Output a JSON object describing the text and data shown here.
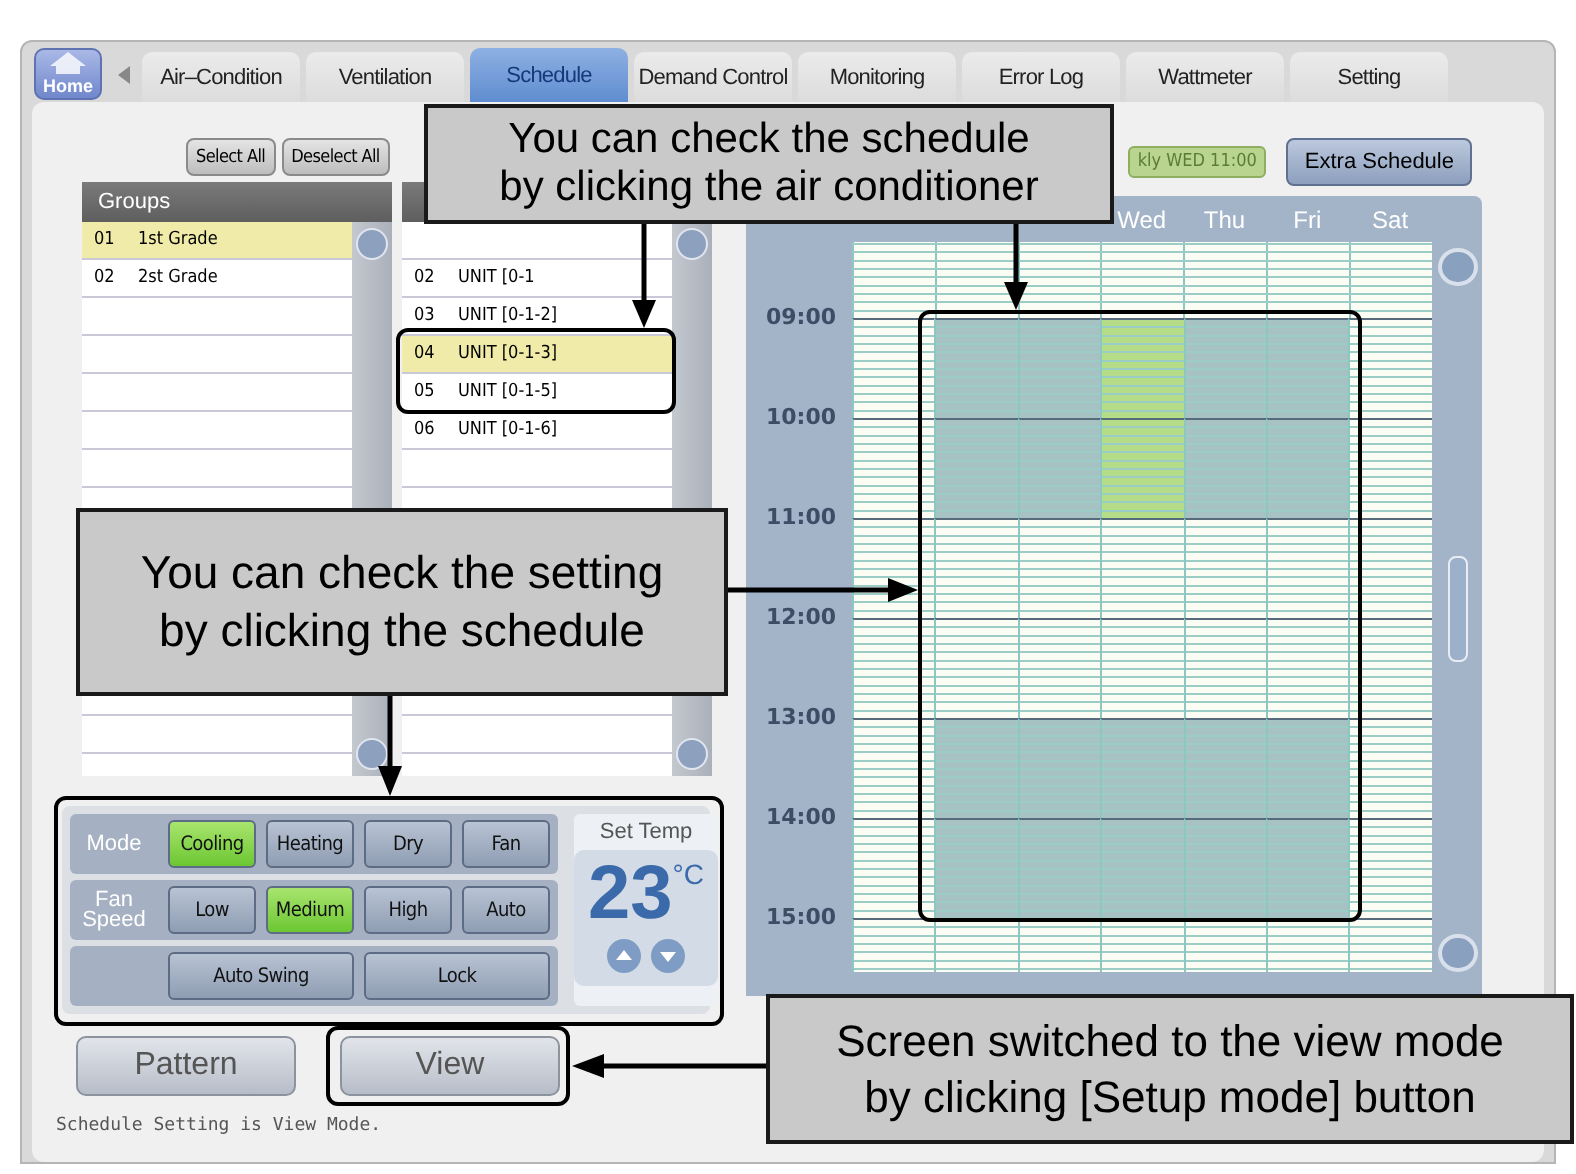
{
  "tabs": {
    "home": "Home",
    "items": [
      {
        "label": "Air–Condition",
        "selected": false
      },
      {
        "label": "Ventilation",
        "selected": false
      },
      {
        "label": "Schedule",
        "selected": true
      },
      {
        "label": "Demand Control",
        "selected": false
      },
      {
        "label": "Monitoring",
        "selected": false
      },
      {
        "label": "Error Log",
        "selected": false
      },
      {
        "label": "Wattmeter",
        "selected": false
      },
      {
        "label": "Setting",
        "selected": false
      }
    ]
  },
  "group_buttons": [
    "Select All",
    "Deselect All"
  ],
  "groups": {
    "title": "Groups",
    "rows": [
      {
        "num": "01",
        "name": "1st Grade",
        "selected": true
      },
      {
        "num": "02",
        "name": "2st Grade",
        "selected": false
      }
    ]
  },
  "units": {
    "rows": [
      {
        "num": "02",
        "name": "UNIT [0-1",
        "selected": false
      },
      {
        "num": "03",
        "name": "UNIT [0-1-2]",
        "selected": false
      },
      {
        "num": "04",
        "name": "UNIT [0-1-3]",
        "selected": true
      },
      {
        "num": "05",
        "name": "UNIT [0-1-5]",
        "selected": false
      },
      {
        "num": "06",
        "name": "UNIT [0-1-6]",
        "selected": false
      }
    ]
  },
  "controls": {
    "rows": [
      {
        "label": "Mode",
        "buttons": [
          {
            "label": "Cooling",
            "selected": true
          },
          {
            "label": "Heating",
            "selected": false
          },
          {
            "label": "Dry",
            "selected": false
          },
          {
            "label": "Fan",
            "selected": false
          }
        ]
      },
      {
        "label": "Fan Speed",
        "buttons": [
          {
            "label": "Low",
            "selected": false
          },
          {
            "label": "Medium",
            "selected": true
          },
          {
            "label": "High",
            "selected": false
          },
          {
            "label": "Auto",
            "selected": false
          }
        ]
      },
      {
        "buttons": [
          {
            "label": "Auto Swing",
            "selected": false
          },
          {
            "label": "Lock",
            "selected": false
          }
        ]
      }
    ],
    "set_temp": {
      "label": "Set Temp",
      "value": "23",
      "unit": "°C"
    }
  },
  "bottom_buttons": [
    "Pattern",
    "View"
  ],
  "status": "Schedule Setting is View Mode.",
  "schedule": {
    "current": "kly WED 11:00",
    "extra_button": "Extra Schedule",
    "days": [
      "Wed",
      "Thu",
      "Fri",
      "Sat"
    ],
    "hours": [
      {
        "label": "09:00",
        "cells": [
          {
            "scheduled": false,
            "selected": false
          },
          {
            "scheduled": true,
            "selected": false
          },
          {
            "scheduled": true,
            "selected": false
          },
          {
            "scheduled": true,
            "selected": true
          },
          {
            "scheduled": true,
            "selected": false
          },
          {
            "scheduled": true,
            "selected": false
          },
          {
            "scheduled": false,
            "selected": false
          }
        ]
      },
      {
        "label": "10:00",
        "cells": [
          {
            "scheduled": false,
            "selected": false
          },
          {
            "scheduled": true,
            "selected": false
          },
          {
            "scheduled": true,
            "selected": false
          },
          {
            "scheduled": true,
            "selected": true
          },
          {
            "scheduled": true,
            "selected": false
          },
          {
            "scheduled": true,
            "selected": false
          },
          {
            "scheduled": false,
            "selected": false
          }
        ]
      },
      {
        "label": "11:00",
        "cells": [
          {
            "scheduled": false,
            "selected": false
          },
          {
            "scheduled": false,
            "selected": false
          },
          {
            "scheduled": false,
            "selected": false
          },
          {
            "scheduled": false,
            "selected": false
          },
          {
            "scheduled": false,
            "selected": false
          },
          {
            "scheduled": false,
            "selected": false
          },
          {
            "scheduled": false,
            "selected": false
          }
        ]
      },
      {
        "label": "12:00",
        "cells": [
          {
            "scheduled": false,
            "selected": false
          },
          {
            "scheduled": false,
            "selected": false
          },
          {
            "scheduled": false,
            "selected": false
          },
          {
            "scheduled": false,
            "selected": false
          },
          {
            "scheduled": false,
            "selected": false
          },
          {
            "scheduled": false,
            "selected": false
          },
          {
            "scheduled": false,
            "selected": false
          }
        ]
      },
      {
        "label": "13:00",
        "cells": [
          {
            "scheduled": false,
            "selected": false
          },
          {
            "scheduled": true,
            "selected": false
          },
          {
            "scheduled": true,
            "selected": false
          },
          {
            "scheduled": true,
            "selected": false
          },
          {
            "scheduled": true,
            "selected": false
          },
          {
            "scheduled": true,
            "selected": false
          },
          {
            "scheduled": false,
            "selected": false
          }
        ]
      },
      {
        "label": "14:00",
        "cells": [
          {
            "scheduled": false,
            "selected": false
          },
          {
            "scheduled": true,
            "selected": false
          },
          {
            "scheduled": true,
            "selected": false
          },
          {
            "scheduled": true,
            "selected": false
          },
          {
            "scheduled": true,
            "selected": false
          },
          {
            "scheduled": true,
            "selected": false
          },
          {
            "scheduled": false,
            "selected": false
          }
        ]
      },
      {
        "label": "15:00",
        "cells": [
          {
            "scheduled": false,
            "selected": false
          },
          {
            "scheduled": false,
            "selected": false
          },
          {
            "scheduled": false,
            "selected": false
          },
          {
            "scheduled": false,
            "selected": false
          },
          {
            "scheduled": false,
            "selected": false
          },
          {
            "scheduled": false,
            "selected": false
          },
          {
            "scheduled": false,
            "selected": false
          }
        ]
      }
    ]
  },
  "callouts": [
    {
      "text": "You can check the schedule\nby clicking the air conditioner"
    },
    {
      "text": "You can check the setting\nby clicking the schedule"
    },
    {
      "text": "Screen switched to the view mode\nby clicking [Setup mode] button"
    }
  ]
}
